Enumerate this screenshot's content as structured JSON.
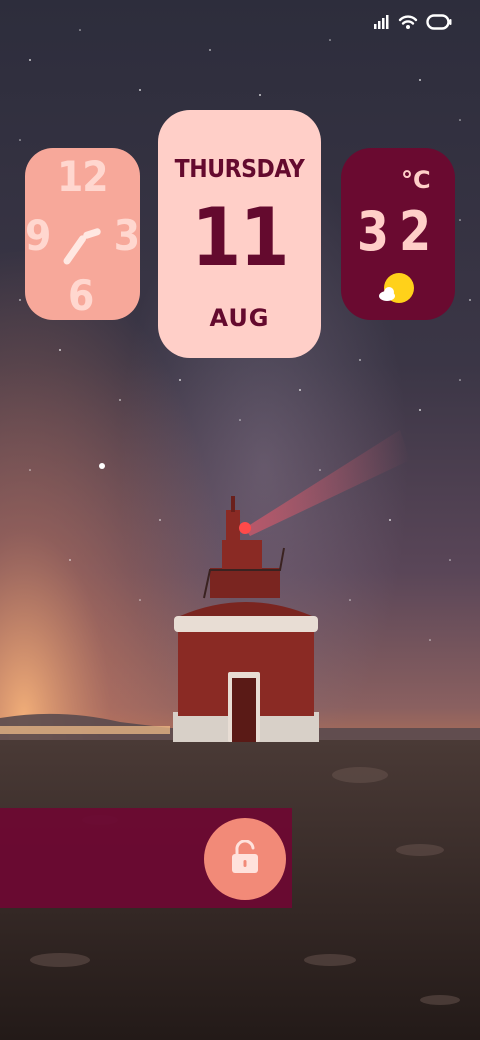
{
  "status_bar": {
    "signal_icon": "signal-bars-icon",
    "wifi_icon": "wifi-icon",
    "battery_icon": "battery-icon"
  },
  "clock_widget": {
    "numbers": [
      "12",
      "9",
      "3",
      "6"
    ]
  },
  "date_widget": {
    "day": "THURSDAY",
    "date": "11",
    "month": "AUG"
  },
  "weather_widget": {
    "unit": "°C",
    "temperature": "32",
    "condition_icon": "partly-sunny-icon"
  },
  "unlock": {
    "icon": "unlock-padlock-icon"
  },
  "colors": {
    "clock_bg": "#f7a89a",
    "date_bg": "#ffcfc8",
    "weather_bg": "#6a0a30",
    "accent_dark": "#640a2e",
    "unlock_button": "#f28a78"
  }
}
